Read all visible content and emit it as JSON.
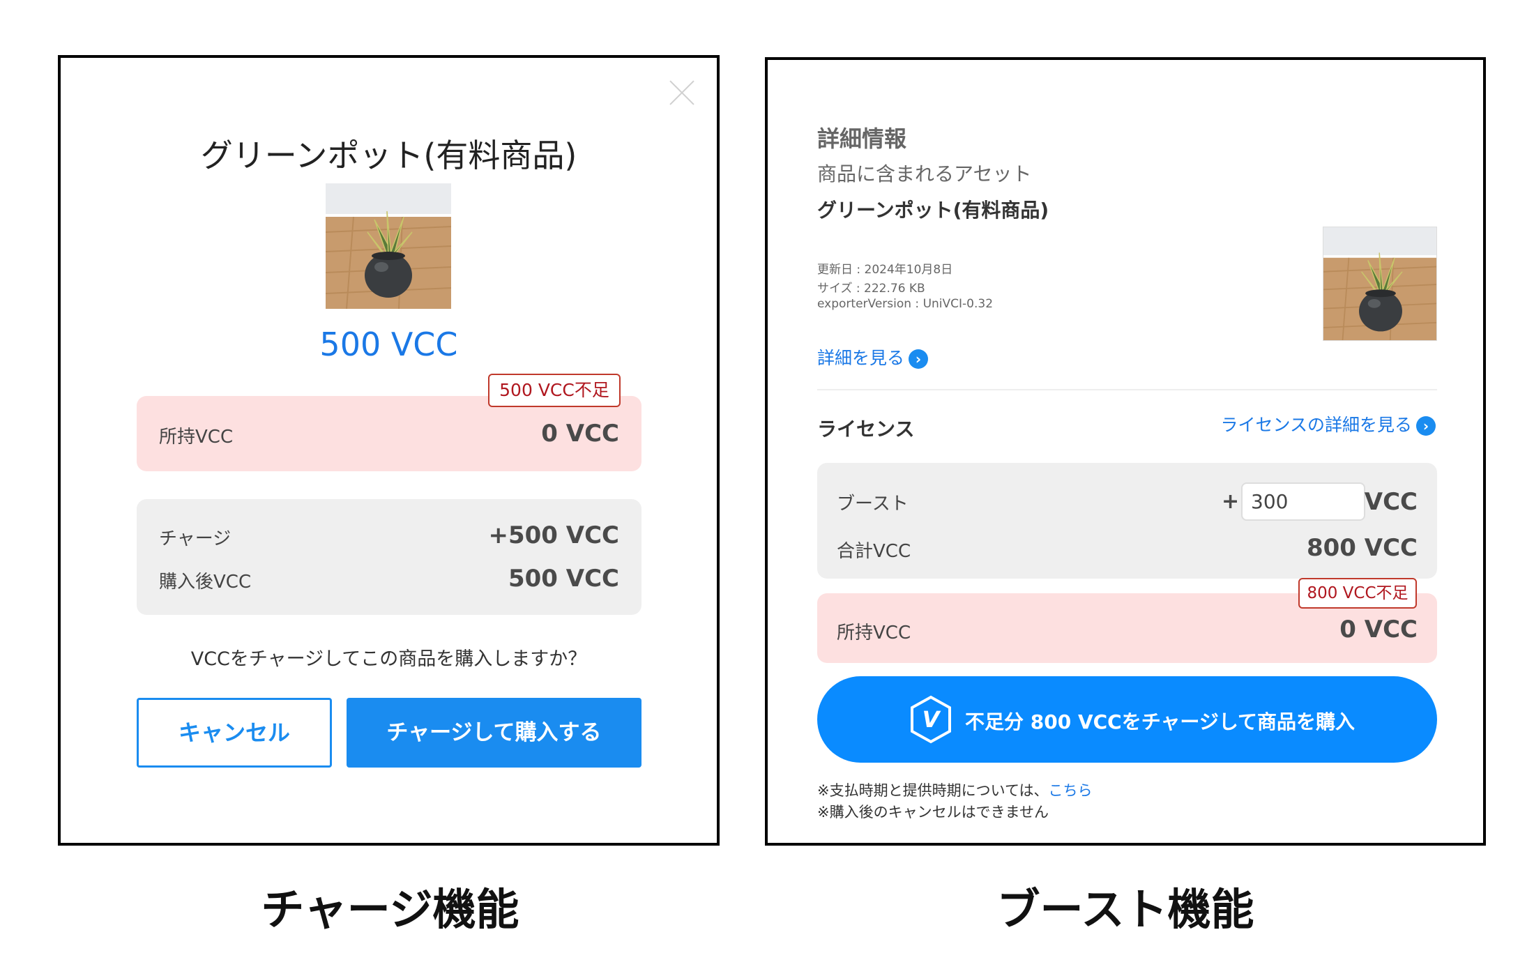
{
  "charge_panel": {
    "product_title": "グリーンポット(有料商品)",
    "price": "500 VCC",
    "shortage_badge": "500 VCC不足",
    "owned": {
      "label": "所持VCC",
      "value": "0 VCC"
    },
    "charge": {
      "label": "チャージ",
      "value": "+500 VCC"
    },
    "after_purchase": {
      "label": "購入後VCC",
      "value": "500 VCC"
    },
    "question": "VCCをチャージしてこの商品を購入しますか？",
    "cancel_label": "キャンセル",
    "confirm_label": "チャージして購入する"
  },
  "boost_panel": {
    "section_title": "詳細情報",
    "subtitle": "商品に含まれるアセット",
    "product_name": "グリーンポット(有料商品)",
    "meta": {
      "updated": "更新日 : 2024年10月8日",
      "size": "サイズ : 222.76 KB",
      "exporter": "exporterVersion : UniVCI-0.32"
    },
    "details_link": "詳細を見る",
    "license_title": "ライセンス",
    "license_link": "ライセンスの詳細を見る",
    "boost": {
      "label": "ブースト",
      "plus": "+",
      "value": "300",
      "unit": "VCC"
    },
    "total": {
      "label": "合計VCC",
      "value": "800 VCC"
    },
    "shortage_badge": "800 VCC不足",
    "owned": {
      "label": "所持VCC",
      "value": "0 VCC"
    },
    "buy_button": "不足分 800 VCCをチャージして商品を購入",
    "buy_icon_letter": "V",
    "note1_prefix": "※支払時期と提供時期については、",
    "note1_link": "こちら",
    "note2": "※購入後のキャンセルはできません"
  },
  "captions": {
    "left": "チャージ機能",
    "right": "ブースト機能"
  },
  "colors": {
    "accent": "#1a8cf0",
    "price_blue": "#1a78e6",
    "shortage_bg": "#fde0e0",
    "badge_red": "#b0171f",
    "card_gray": "#efefef"
  },
  "icons": [
    "close-icon",
    "plant-thumbnail",
    "chevron-right-icon",
    "vcc-hexagon-icon"
  ]
}
